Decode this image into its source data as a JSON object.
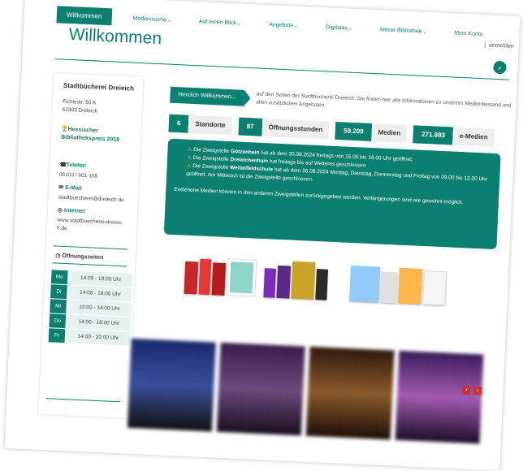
{
  "nav": {
    "items": [
      {
        "label": "Willkommen",
        "chevron": false
      },
      {
        "label": "Mediensuche",
        "chevron": true
      },
      {
        "label": "Auf einen Blick",
        "chevron": true
      },
      {
        "label": "Angebote",
        "chevron": true
      },
      {
        "label": "Digitales",
        "chevron": true
      },
      {
        "label": "Meine Bibliothek",
        "chevron": true
      },
      {
        "label": "Mein Konto",
        "chevron": false
      }
    ],
    "login": "anmelden"
  },
  "page_title": "Willkommen",
  "sidebar": {
    "name": "Stadtbücherei Dreieich",
    "address1": "Fichtestr. 50 A",
    "address2": "63303 Dreieich",
    "award": "Hessischer Bibliothekspreis 2018",
    "phone_label": "Telefon",
    "phone": "06103 / 601-165",
    "email_label": "E-Mail",
    "email": "stadtbuecherei@dreieich.de",
    "internet_label": "Internet",
    "internet": "www.stadtbuecherei-dreieich.de",
    "hours_title": "Öffnungszeiten",
    "hours": [
      {
        "day": "Mo",
        "time": "14:00 - 18:00 Uhr"
      },
      {
        "day": "Di",
        "time": "14:00 - 18:00 Uhr"
      },
      {
        "day": "Mi",
        "time": "10:00 - 14:00 Uhr"
      },
      {
        "day": "Do",
        "time": "14:00 - 18:00 Uhr"
      },
      {
        "day": "Fr",
        "time": "14:00 - 20:00 Uhr"
      }
    ]
  },
  "main": {
    "welcome_tag": "Herzlich Willkommen...",
    "intro": "auf den Seiten der Stadtbücherei Dreieich. Sie finden hier alle Informationen zu unserem Medienbestand und allen zusätzlichen Angeboten.",
    "stats": [
      {
        "num": "6",
        "label": "Standorte"
      },
      {
        "num": "87",
        "label": "Öffnungsstunden"
      },
      {
        "num": "59.200",
        "label": "Medien"
      },
      {
        "num": "271.883",
        "label": "e-Medien"
      }
    ],
    "notice": {
      "line1_pre": "Die Zweigstelle ",
      "line1_bold": "Götzenhain",
      "line1_post": " hat ab dem 30.08.2024 freitags von 15.00 bis 18.00 Uhr geöffnet.",
      "line2_pre": "Die Zweigstelle ",
      "line2_bold": "Dreieichenhain",
      "line2_post": " hat freitags bis auf Weiteres geschlossen.",
      "line3_pre": "Die Zweigstelle ",
      "line3_bold": "Weibelfeldschule",
      "line3_post": " hat ab dem 26.08.2024 Montag, Dienstag, Donnerstag und Freitag von 09.00 bis 12.00 Uhr geöffnet. Am Mittwoch ist die Zweigstelle geschlossen.",
      "line4": "Entliehene Medien können in den anderen Zweigstellen zurückgegeben werden. Verlängerungen sind wie gewohnt möglich."
    },
    "warning_icon": "warning-icon",
    "gallery_prev": "‹",
    "gallery_next": "›"
  },
  "colors": {
    "accent": "#0b8071",
    "warning": "#f3b91b",
    "gallery_nav": "#d0312d"
  }
}
